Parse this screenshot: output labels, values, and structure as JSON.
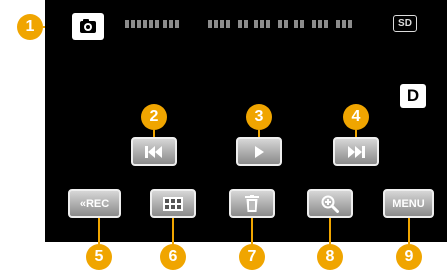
{
  "callouts": [
    "1",
    "2",
    "3",
    "4",
    "5",
    "6",
    "7",
    "8",
    "9"
  ],
  "status": {
    "sd_label": "SD",
    "mode_badge": "D"
  },
  "buttons": {
    "rec_label": "«REC",
    "menu_label": "MENU"
  },
  "colors": {
    "callout": "#f0a500",
    "screen": "#000000",
    "button": "#b5b5b5"
  }
}
